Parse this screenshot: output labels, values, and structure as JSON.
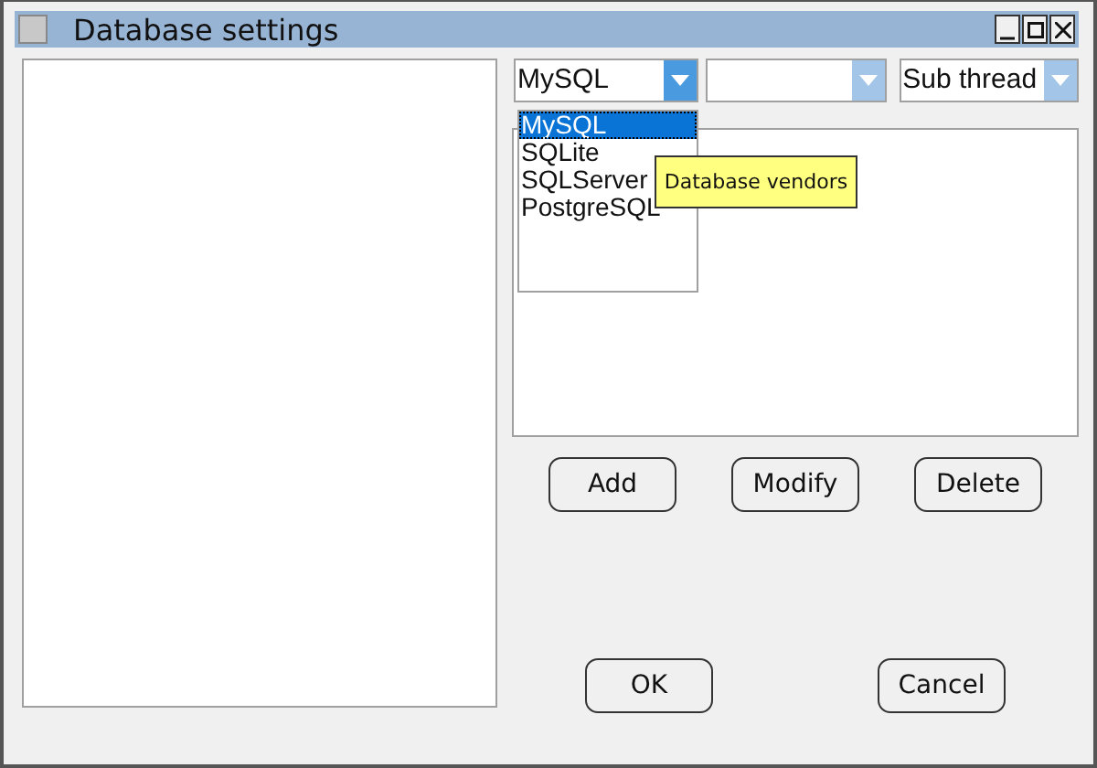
{
  "window": {
    "title": "Database settings"
  },
  "combos": [
    {
      "value": "MySQL",
      "open": true
    },
    {
      "open": false
    },
    {
      "value": "Sub thread",
      "open": false
    }
  ],
  "dropdown": {
    "items": [
      {
        "label": "MySQL",
        "selected": true
      },
      {
        "label": "SQLite",
        "selected": false
      },
      {
        "label": "SQLServer",
        "selected": false
      },
      {
        "label": "PostgreSQL",
        "selected": false
      }
    ]
  },
  "tooltip": "Database vendors",
  "buttons": [
    "Add",
    "Modify",
    "Delete"
  ],
  "dialog_buttons": [
    "OK",
    "Cancel"
  ]
}
